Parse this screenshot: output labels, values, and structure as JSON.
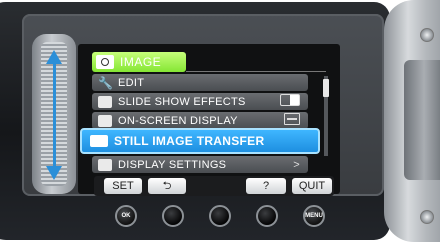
{
  "menu": {
    "header": {
      "label": "IMAGE",
      "icon": "camera-icon"
    },
    "items": [
      {
        "label": "EDIT",
        "icon": "wrench-icon",
        "right": ""
      },
      {
        "label": "SLIDE SHOW EFFECTS",
        "icon": "slideshow-icon",
        "right": "toggle"
      },
      {
        "label": "ON-SCREEN DISPLAY",
        "icon": "osd-icon",
        "right": "osd"
      },
      {
        "label": "STILL IMAGE TRANSFER",
        "icon": "transfer-icon",
        "right": "",
        "selected": true
      },
      {
        "label": "DISPLAY SETTINGS",
        "icon": "display-settings-icon",
        "right": ">"
      }
    ]
  },
  "softbar": {
    "set": "SET",
    "back": "⮌",
    "help": "?",
    "quit": "QUIT"
  },
  "physical_buttons": {
    "ok": "OK",
    "menu": "MENU"
  },
  "colors": {
    "selected": "#1e8fe0",
    "header": "#85e634",
    "slider_arrow": "#2b8fd8"
  }
}
